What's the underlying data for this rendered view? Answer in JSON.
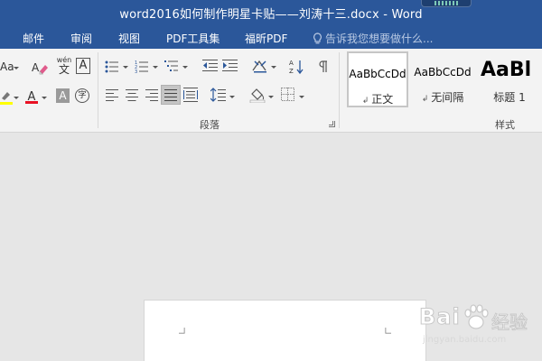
{
  "window": {
    "title": "word2016如何制作明星卡贴——刘涛十三.docx - Word"
  },
  "tabs": [
    {
      "label": "邮件"
    },
    {
      "label": "审阅"
    },
    {
      "label": "视图"
    },
    {
      "label": "PDF工具集"
    },
    {
      "label": "福昕PDF"
    }
  ],
  "tell_me": {
    "placeholder": "告诉我您想要做什么..."
  },
  "ribbon": {
    "font_group": {
      "grow_font_label": "Aa",
      "phonetic_label": "wén",
      "phonetic_char": "文",
      "char_border_label": "A",
      "font_color_label": "A",
      "char_shading_label": "A",
      "enclose_char_label": "字",
      "highlight_color": "#ffff00",
      "font_color": "#e81123"
    },
    "paragraph_group": {
      "label": "段落"
    },
    "styles_group": {
      "label": "样式",
      "items": [
        {
          "sample": "AaBbCcDd",
          "name": "正文",
          "selected": true
        },
        {
          "sample": "AaBbCcDd",
          "name": "无间隔",
          "selected": false
        },
        {
          "sample": "AaBl",
          "name": "标题 1",
          "selected": false
        }
      ]
    }
  },
  "watermark": {
    "brand": "Bai",
    "brand_suffix": "经验",
    "url": "jingyan.baidu.com"
  }
}
